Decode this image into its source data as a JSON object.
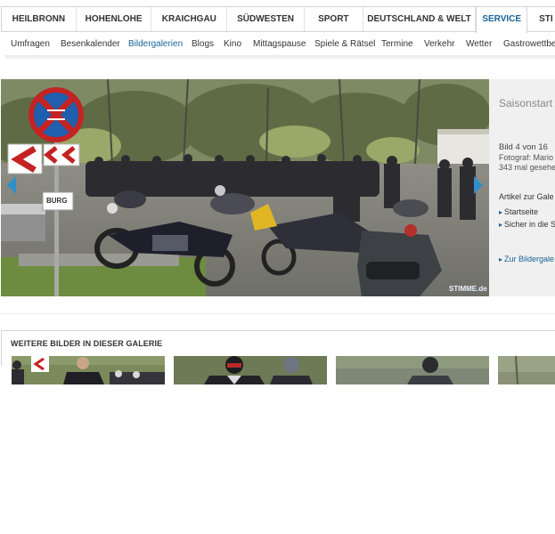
{
  "topnav": {
    "items": [
      {
        "label": "Heilbronn"
      },
      {
        "label": "Hohenlohe"
      },
      {
        "label": "Kraichgau"
      },
      {
        "label": "Südwesten"
      },
      {
        "label": "Sport"
      },
      {
        "label": "Deutschland & Welt"
      },
      {
        "label": "Service",
        "active": true
      },
      {
        "label": "Sti"
      }
    ]
  },
  "subnav": {
    "items": [
      {
        "label": "Umfragen"
      },
      {
        "label": "Besenkalender"
      },
      {
        "label": "Bildergalerien",
        "active": true
      },
      {
        "label": "Blogs"
      },
      {
        "label": "Kino"
      },
      {
        "label": "Mittagspause"
      },
      {
        "label": "Spiele & Rätsel"
      },
      {
        "label": "Termine"
      },
      {
        "label": "Verkehr"
      },
      {
        "label": "Wetter"
      },
      {
        "label": "Gastrowettbew"
      }
    ]
  },
  "gallery": {
    "title": "Saisonstart Motorradfa",
    "counter": "Bild 4 von 16",
    "photographer": "Fotograf: Mario",
    "views": "343 mal gesehe",
    "articles_heading": "Artikel zur Gale",
    "links": [
      "Startseite",
      "Sicher in die S"
    ],
    "back_link": "Zur Bildergale",
    "watermark": "STIMME.de",
    "sign_text": "BURG",
    "prev_icon": "chevron-left-icon",
    "next_icon": "chevron-right-icon"
  },
  "more": {
    "title": "WEITERE BILDER IN DIESER GALERIE",
    "thumbs": [
      {
        "name": "thumbnail-1"
      },
      {
        "name": "thumbnail-2"
      },
      {
        "name": "thumbnail-3"
      },
      {
        "name": "thumbnail-4"
      }
    ]
  },
  "colors": {
    "accent": "#1a6496",
    "nav_arrow": "#2f8fc9",
    "panel_bg": "#f0f0f0"
  }
}
